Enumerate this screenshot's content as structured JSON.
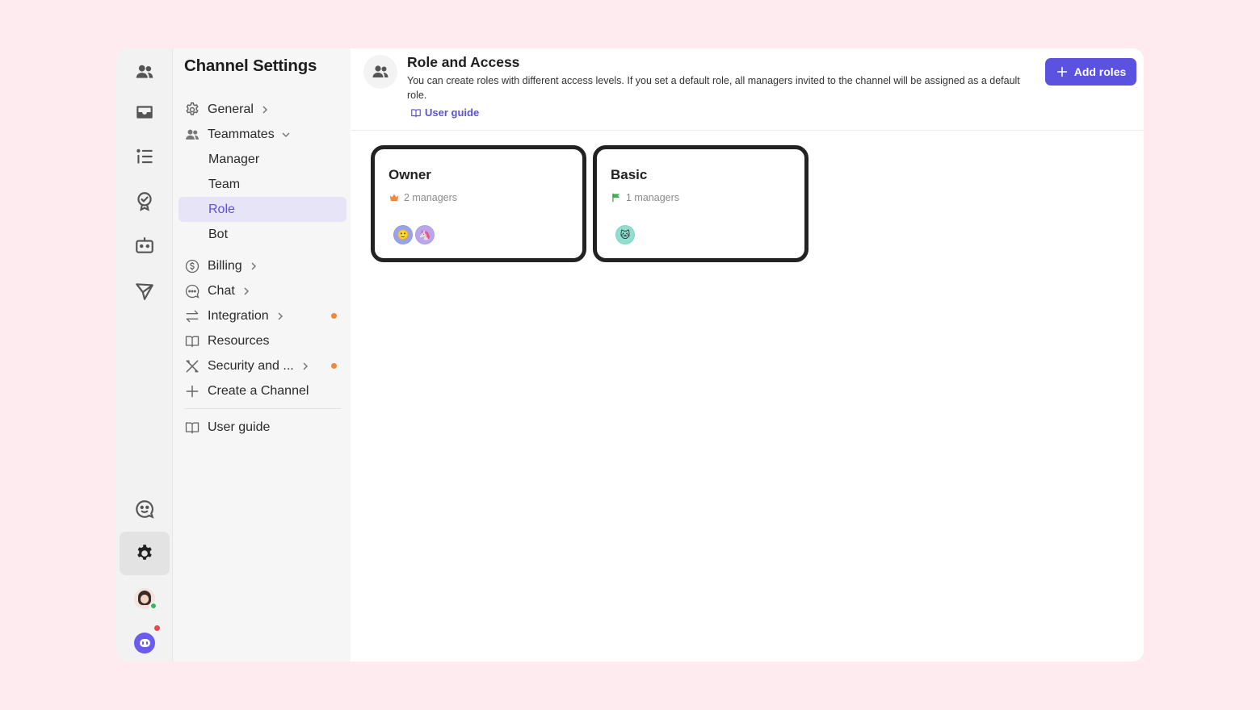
{
  "sidebar": {
    "title": "Channel Settings",
    "items": [
      {
        "label": "General"
      },
      {
        "label": "Teammates"
      },
      {
        "label": "Manager"
      },
      {
        "label": "Team"
      },
      {
        "label": "Role"
      },
      {
        "label": "Bot"
      },
      {
        "label": "Billing"
      },
      {
        "label": "Chat"
      },
      {
        "label": "Integration"
      },
      {
        "label": "Resources"
      },
      {
        "label": "Security and ..."
      },
      {
        "label": "Create a Channel"
      },
      {
        "label": "User guide"
      }
    ],
    "active_item": "Role"
  },
  "header": {
    "title": "Role and Access",
    "description": "You can create roles with different access levels. If you set a default role, all managers invited to the channel will be assigned as a default role.",
    "guide_link": "User guide",
    "add_button": "Add roles"
  },
  "roles": [
    {
      "name": "Owner",
      "count_text": "2 managers",
      "icon": "crown-icon",
      "avatars": [
        "🙂",
        "🦄"
      ]
    },
    {
      "name": "Basic",
      "count_text": "1 managers",
      "icon": "flag-icon",
      "avatars": [
        "🐱"
      ]
    }
  ],
  "colors": {
    "accent": "#5b52e0",
    "notification_dot": "#f0883e",
    "background": "#fdebef"
  }
}
